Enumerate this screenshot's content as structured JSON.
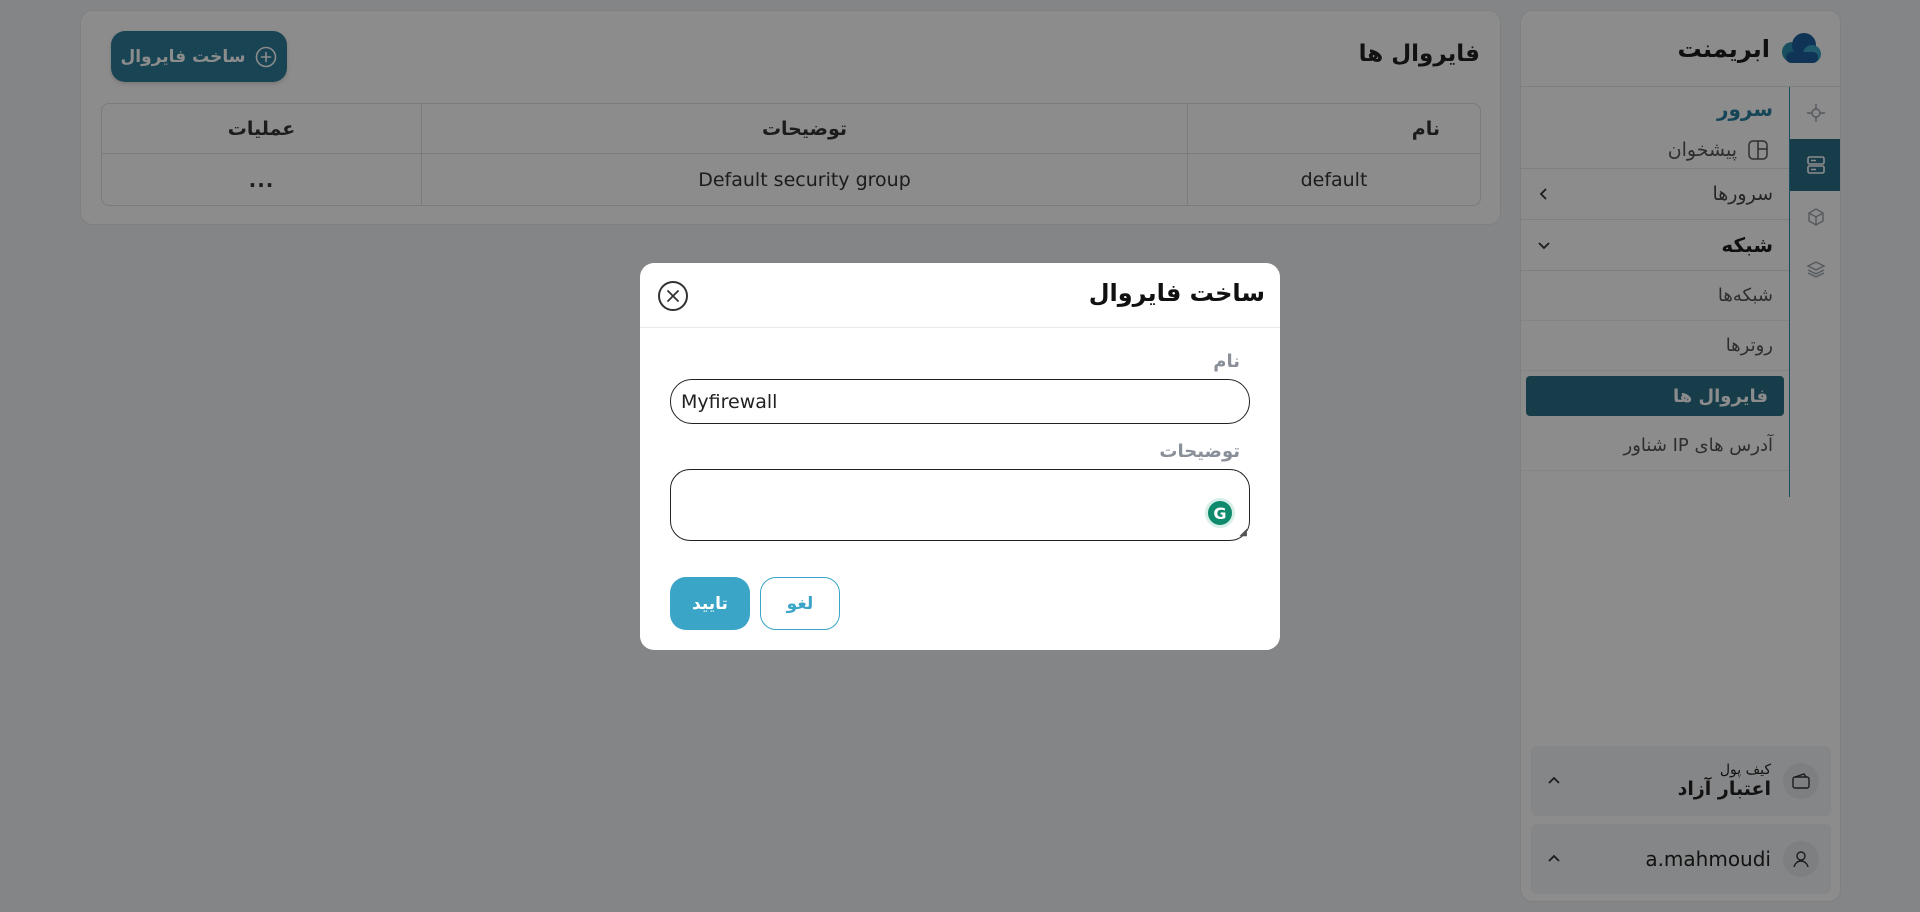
{
  "brand": {
    "name": "ابریمنت",
    "logo_icon": "cloud-logo-icon"
  },
  "sidebar": {
    "group": "سرور",
    "desk": "پیشخوان",
    "servers": "سرورها",
    "network": "شبکه",
    "networks": "شبکه‌ها",
    "routers": "روترها",
    "firewalls": "فایروال ها",
    "floating_ips": "آدرس های IP شناور",
    "accent_color": "#2b6f87"
  },
  "wallet": {
    "label": "کیف پول",
    "value": "اعتبار آزاد"
  },
  "user": {
    "name": "a.mahmoudi"
  },
  "page": {
    "title": "فایروال ها",
    "create_button": "ساخت فایروال"
  },
  "table": {
    "headers": {
      "name": "نام",
      "description": "توضیحات",
      "actions": "عملیات"
    },
    "rows": [
      {
        "name": "default",
        "description": "Default security group",
        "actions": "..."
      }
    ]
  },
  "modal": {
    "title": "ساخت فایروال",
    "name_label": "نام",
    "name_value": "Myfirewall",
    "description_label": "توضیحات",
    "description_value": "",
    "cancel": "لغو",
    "confirm": "تایید",
    "button_color": "#3aa5c6"
  }
}
